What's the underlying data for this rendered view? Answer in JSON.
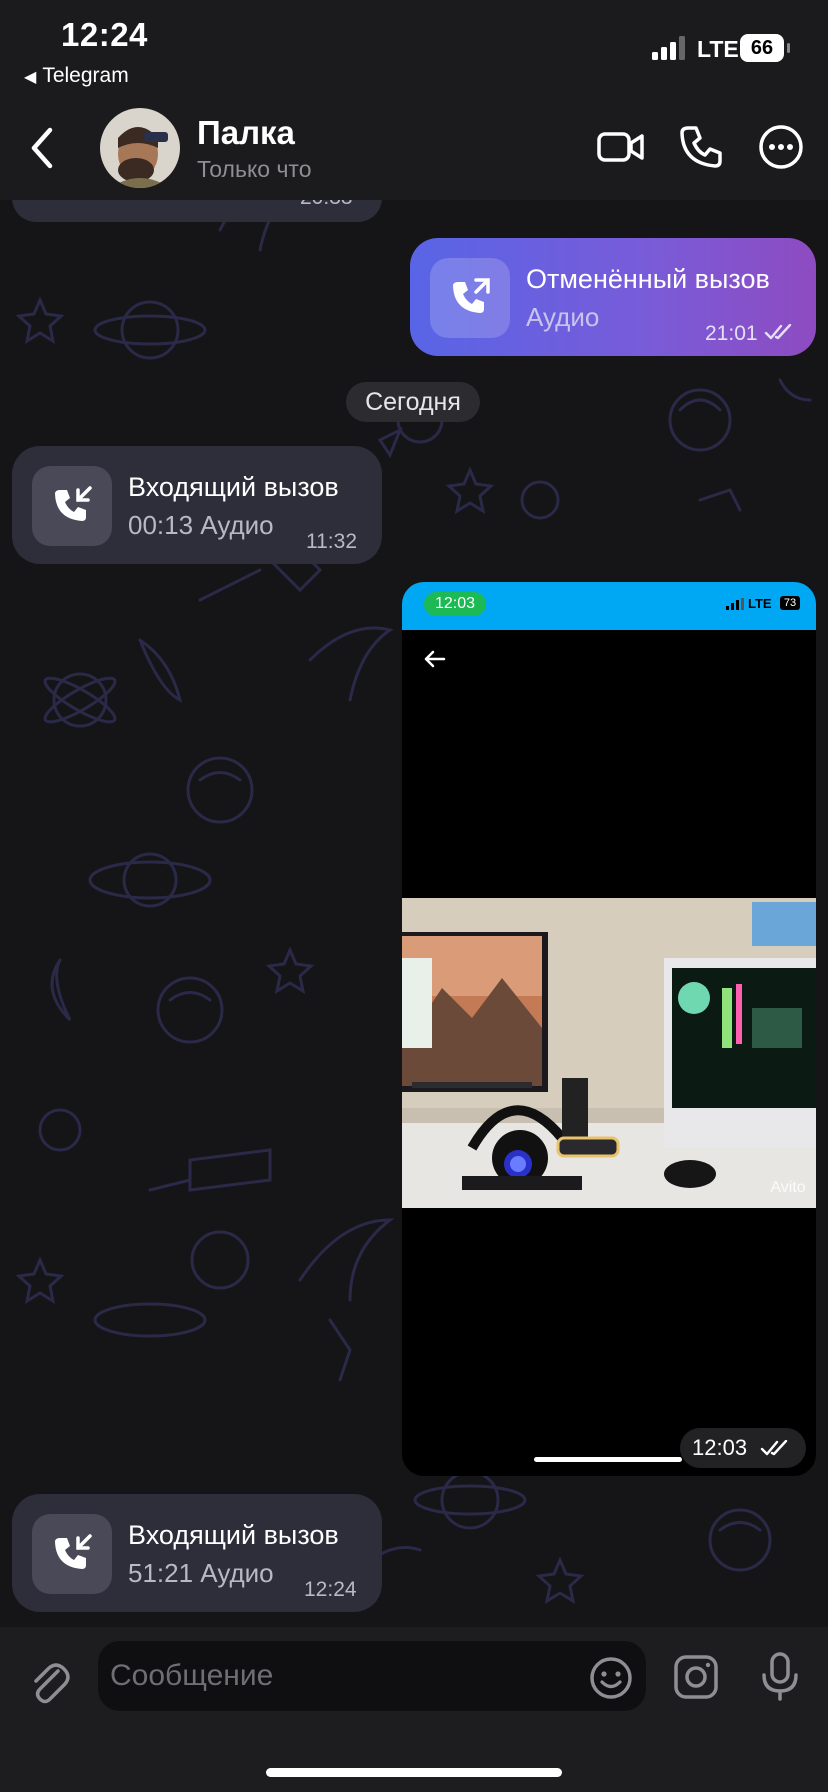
{
  "status_bar": {
    "time": "12:24",
    "back_app": "Telegram",
    "network": "LTE",
    "battery": "66"
  },
  "header": {
    "name": "Палка",
    "status": "Только что"
  },
  "messages": {
    "top_partial_time": "20:33",
    "cancelled_call": {
      "title": "Отменённый вызов",
      "subtitle": "Аудио",
      "time": "21:01"
    },
    "date_separator": "Сегодня",
    "incoming_call_1": {
      "title": "Входящий вызов",
      "subtitle": "00:13 Аудио",
      "time": "11:32"
    },
    "photo": {
      "inner_status_time": "12:03",
      "inner_network": "LTE",
      "inner_battery": "73",
      "watermark": "Avito",
      "time": "12:03"
    },
    "incoming_call_2": {
      "title": "Входящий вызов",
      "subtitle": "51:21 Аудио",
      "time": "12:24"
    }
  },
  "composer": {
    "placeholder": "Сообщение"
  },
  "colors": {
    "background": "#151417",
    "incoming_bubble": "#2e2d3a",
    "outgoing_gradient_start": "#5865e6",
    "outgoing_gradient_end": "#8e4bc0",
    "accent_blue": "#00a8f4"
  }
}
